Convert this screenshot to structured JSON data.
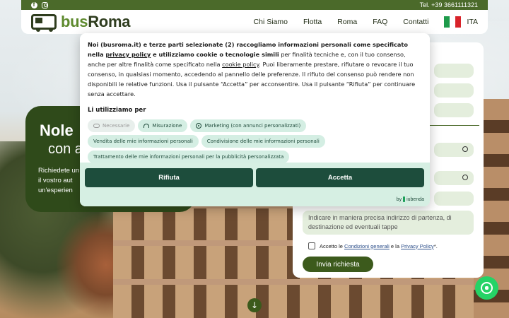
{
  "topbar": {
    "phone": "Tel. +39 3661111321"
  },
  "header": {
    "logo_text_a": "bus",
    "logo_text_b": "Roma",
    "nav": [
      "Chi Siamo",
      "Flotta",
      "Roma",
      "FAQ",
      "Contatti"
    ],
    "lang": "ITA"
  },
  "hero": {
    "title": "Nole",
    "subtitle": "con a",
    "text_lines": [
      "Richiedete un",
      "il vostro aut",
      "un'esperien"
    ]
  },
  "form": {
    "textarea_placeholder": "Indicare in maniera precisa indirizzo di partenza, di destinazione ed eventuali tappe",
    "consent_prefix": "Accetto le ",
    "consent_link1": "Condizioni generali",
    "consent_mid": " e la ",
    "consent_link2": "Privacy Policy",
    "consent_suffix": "*.",
    "submit": "Invia richiesta"
  },
  "cookie": {
    "p1_bold_a": "Noi (busroma.it) e terze parti selezionate (2) raccogliamo informazioni personali come specificato nella ",
    "p1_link": "privacy policy",
    "p1_bold_b": " e utilizziamo cookie o tecnologie simili",
    "p1_rest_a": " per finalità tecniche e, con il tuo consenso, anche per altre finalità come specificato nella ",
    "p1_link2": "cookie policy",
    "p1_rest_b": ". Puoi liberamente prestare, rifiutare o revocare il tuo consenso, in qualsiasi momento, accedendo al pannello delle preferenze. Il rifiuto del consenso può rendere non disponibili le relative funzioni. Usa il pulsante “Accetta” per acconsentire. Usa il pulsante “Rifiuta” per continuare senza accettare.",
    "subtitle": "Li utilizziamo per",
    "chips": [
      "Necessarie",
      "Misurazione",
      "Marketing (con annunci personalizzati)",
      "Vendita delle mie informazioni personali",
      "Condivisione delle mie informazioni personali",
      "Trattamento delle mie informazioni personali per la pubblicità personalizzata"
    ],
    "reject": "Rifiuta",
    "accept": "Accetta",
    "by": "by",
    "brand": "iubenda"
  }
}
